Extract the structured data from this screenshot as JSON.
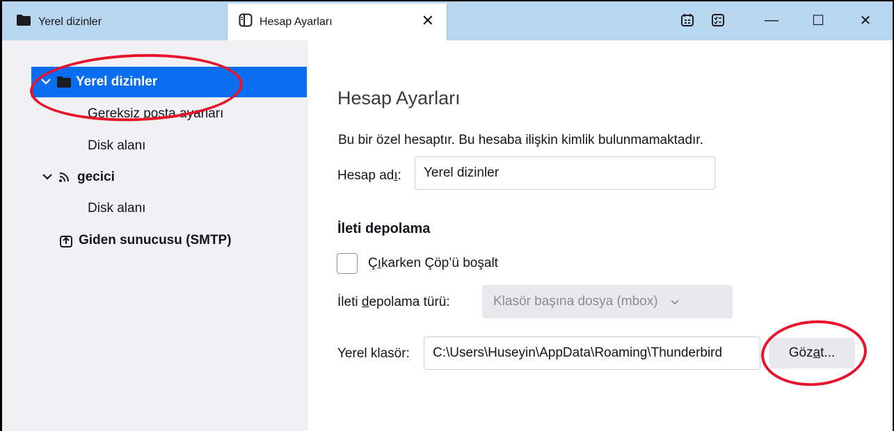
{
  "tabs": [
    {
      "label": "Yerel dizinler",
      "icon": "folder-icon"
    },
    {
      "label": "Hesap Ayarları",
      "icon": "settings-page-icon"
    }
  ],
  "tab_close_glyph": "✕",
  "window_controls": {
    "minimize": "—",
    "maximize": "☐",
    "close": "✕"
  },
  "sidebar": {
    "items": [
      {
        "label": "Yerel dizinler",
        "icon": "folder-icon",
        "expanded": true,
        "selected": true
      },
      {
        "label": "Gereksiz posta ayarları"
      },
      {
        "label": "Disk alanı"
      },
      {
        "label": "gecici",
        "icon": "rss-feed-icon",
        "expanded": true
      },
      {
        "label": "Disk alanı"
      },
      {
        "label": "Giden sunucusu (SMTP)",
        "icon": "outbox-icon"
      }
    ]
  },
  "main": {
    "title": "Hesap Ayarları",
    "info": "Bu bir özel hesaptır. Bu hesaba ilişkin kimlik bulunmamaktadır.",
    "account_name": {
      "label_pre": "Hesap ad",
      "label_ul": "ı",
      "label_post": ":",
      "value": "Yerel dizinler"
    },
    "storage_section": "İleti depolama",
    "empty_trash": {
      "label_pre": "Ç",
      "label_ul": "ı",
      "label_post": "karken Çöp’ü boşalt",
      "checked": false
    },
    "storage_type": {
      "label_pre": "İleti ",
      "label_ul": "d",
      "label_post": "epolama türü:",
      "value": "Klasör başına dosya (mbox)"
    },
    "local_folder": {
      "label": "Yerel klasör:",
      "value": "C:\\Users\\Huseyin\\AppData\\Roaming\\Thunderbird"
    },
    "browse_button": {
      "label_pre": "Göz",
      "label_ul": "a",
      "label_post": "t..."
    }
  },
  "colors": {
    "tabbar": "#b8d6ee",
    "selection": "#0b6ef0",
    "annotation": "#e8132a"
  }
}
